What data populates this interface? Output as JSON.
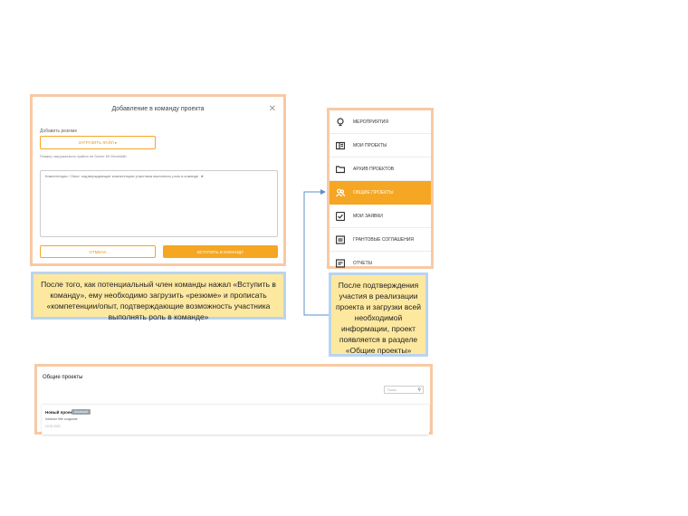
{
  "modal": {
    "title": "Добавление в команду проекта",
    "resume_label": "Добавить резюме",
    "upload_button": "ЗАГРУЗИТЬ ФАЙЛ ▸",
    "file_hint": "Размер загружаемого файла не более 50 Мегабайт",
    "textarea_placeholder": "Компетенции / Опыт, подтверждающие компетенцию участника выполнять роль в команде  ★",
    "cancel_button": "ОТМЕНА",
    "join_button": "ВСТУПИТЬ В КОМАНДУ"
  },
  "note_left": "После того, как потенциальный член команды нажал «Вступить в команду», ему необходимо загрузить «резюме» и прописать «компетенции/опыт, подтверждающие возможность участника выполнять роль в команде»",
  "sidebar": {
    "items": [
      {
        "label": "МЕРОПРИЯТИЯ",
        "icon": "lightbulb-icon"
      },
      {
        "label": "МОИ ПРОЕКТЫ",
        "icon": "book-icon"
      },
      {
        "label": "АРХИВ ПРОЕКТОВ",
        "icon": "folder-icon"
      },
      {
        "label": "ОБЩИЕ ПРОЕКТЫ",
        "icon": "users-icon",
        "active": true
      },
      {
        "label": "МОИ ЗАЯВКИ",
        "icon": "checkbox-icon"
      },
      {
        "label": "ГРАНТОВЫЕ СОГЛАШЕНИЯ",
        "icon": "document-icon"
      },
      {
        "label": "ОТЧЕТЫ",
        "icon": "report-icon"
      }
    ]
  },
  "note_right": "После подтверждения участия в реализации проекта и загрузки всей необходимой информации, проект появляется в разделе «Общие проекты»",
  "projects": {
    "title": "Общие проекты",
    "search_placeholder": "Поиск",
    "card": {
      "name": "Новый проект",
      "badge": "Активный",
      "description": "Instance title создание",
      "date": "10.02.2023"
    }
  },
  "colors": {
    "accent": "#f5a623",
    "frame_orange": "#f8c9a4",
    "frame_blue": "#b9d4f0",
    "note_bg": "#fde8a0",
    "connector": "#5b8fc9"
  }
}
